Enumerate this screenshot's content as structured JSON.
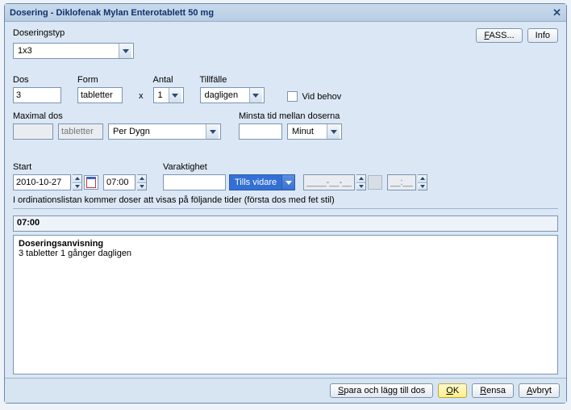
{
  "title": "Dosering - Diklofenak Mylan Enterotablett 50 mg",
  "buttons": {
    "fass": "FASS...",
    "info": "Info",
    "spara": "Spara och lägg till dos",
    "ok": "OK",
    "rensa": "Rensa",
    "avbryt": "Avbryt"
  },
  "labels": {
    "doseringstyp": "Doseringstyp",
    "dos": "Dos",
    "form": "Form",
    "antal": "Antal",
    "tillfalle": "Tillfälle",
    "vidbehov": "Vid behov",
    "maxdos": "Maximal dos",
    "minsta": "Minsta tid mellan doserna",
    "start": "Start",
    "varaktighet": "Varaktighet",
    "ordlistnote": "I ordinationslistan kommer doser att visas på följande tider (första dos med fet stil)",
    "anvisning_h": "Doseringsanvisning"
  },
  "values": {
    "doseringstyp": "1x3",
    "dos": "3",
    "form": "tabletter",
    "antal": "1",
    "tillfalle": "dagligen",
    "maxdos_val": "",
    "maxdos_form": "tabletter",
    "maxdos_per": "Per Dygn",
    "minsta_val": "",
    "minsta_unit": "Minut",
    "start_date": "2010-10-27",
    "start_time": "07:00",
    "varaktighet_val": "",
    "varaktighet_mode": "Tills vidare",
    "end_date": "____-__-__",
    "end_time": "__:__",
    "times": "07:00",
    "anvisning_text": "3 tabletter 1 gånger dagligen",
    "x": "x"
  }
}
